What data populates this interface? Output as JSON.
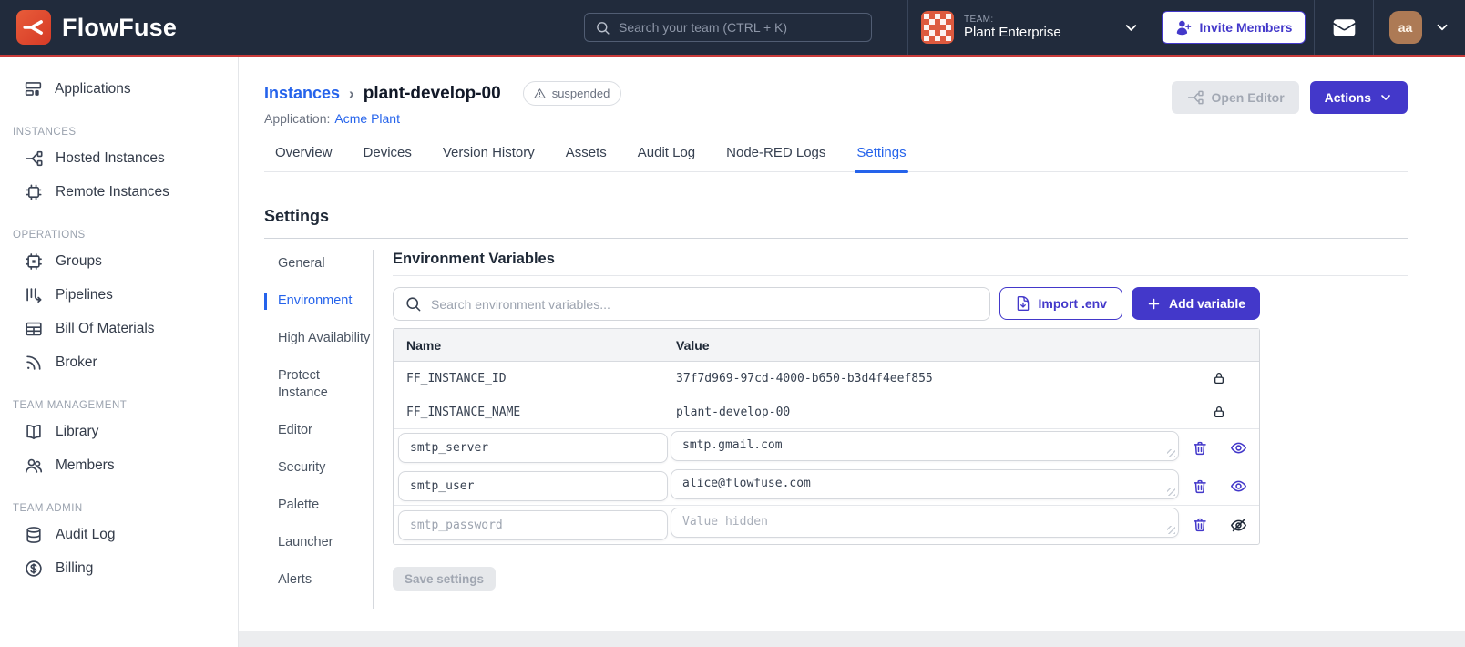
{
  "colors": {
    "navbar_bg": "#212B3C",
    "brand_red": "#D63A26",
    "navbar_red_strip": "#C93B3A",
    "accent_indigo": "#4338CA",
    "link_blue": "#2563EB",
    "text_dark": "#374151",
    "text_muted": "#9CA3AF",
    "table_header_bg": "#F3F4F6",
    "border": "#D3D6DB"
  },
  "navbar": {
    "brand": "FlowFuse",
    "search_placeholder": "Search your team (CTRL + K)",
    "team_label": "TEAM:",
    "team_name": "Plant Enterprise",
    "invite_label": "Invite Members",
    "user_initials": "aa"
  },
  "sidebar": {
    "applications": "Applications",
    "sections": [
      {
        "header": "INSTANCES",
        "items": [
          "Hosted Instances",
          "Remote Instances"
        ]
      },
      {
        "header": "OPERATIONS",
        "items": [
          "Groups",
          "Pipelines",
          "Bill Of Materials",
          "Broker"
        ]
      },
      {
        "header": "TEAM MANAGEMENT",
        "items": [
          "Library",
          "Members"
        ]
      },
      {
        "header": "TEAM ADMIN",
        "items": [
          "Audit Log",
          "Billing"
        ]
      }
    ]
  },
  "page": {
    "breadcrumb_parent": "Instances",
    "breadcrumb_separator": "›",
    "breadcrumb_current": "plant-develop-00",
    "status_badge": "suspended",
    "application_label": "Application:",
    "application_name": "Acme Plant",
    "open_editor_label": "Open Editor",
    "actions_label": "Actions",
    "tabs": [
      "Overview",
      "Devices",
      "Version History",
      "Assets",
      "Audit Log",
      "Node-RED Logs",
      "Settings"
    ],
    "active_tab": "Settings"
  },
  "settings": {
    "title": "Settings",
    "nav": [
      "General",
      "Environment",
      "High Availability",
      "Protect Instance",
      "Editor",
      "Security",
      "Palette",
      "Launcher",
      "Alerts"
    ],
    "active_nav": "Environment",
    "env": {
      "title": "Environment Variables",
      "search_placeholder": "Search environment variables...",
      "import_label": "Import .env",
      "add_label": "Add variable",
      "columns": [
        "Name",
        "Value"
      ],
      "locked_rows": [
        {
          "name": "FF_INSTANCE_ID",
          "value": "37f7d969-97cd-4000-b650-b3d4f4eef855"
        },
        {
          "name": "FF_INSTANCE_NAME",
          "value": "plant-develop-00"
        }
      ],
      "editable_rows": [
        {
          "name": "smtp_server",
          "value": "smtp.gmail.com"
        },
        {
          "name": "smtp_user",
          "value": "alice@flowfuse.com"
        },
        {
          "name": "smtp_password",
          "value": "",
          "value_placeholder": "Value hidden"
        }
      ],
      "save_label": "Save settings"
    }
  },
  "icons": [
    "flowfuse-logo-icon",
    "search-icon",
    "team-avatar-icon",
    "chevron-down-icon",
    "user-plus-icon",
    "envelope-icon",
    "warning-triangle-icon",
    "fork-icon",
    "applications-icon",
    "chip-icon",
    "chip-group-icon",
    "pipelines-icon",
    "table-grid-icon",
    "rss-icon",
    "book-open-icon",
    "users-icon",
    "database-icon",
    "dollar-circle-icon",
    "document-download-icon",
    "plus-icon",
    "lock-icon",
    "trash-icon",
    "eye-icon",
    "eye-off-icon"
  ]
}
